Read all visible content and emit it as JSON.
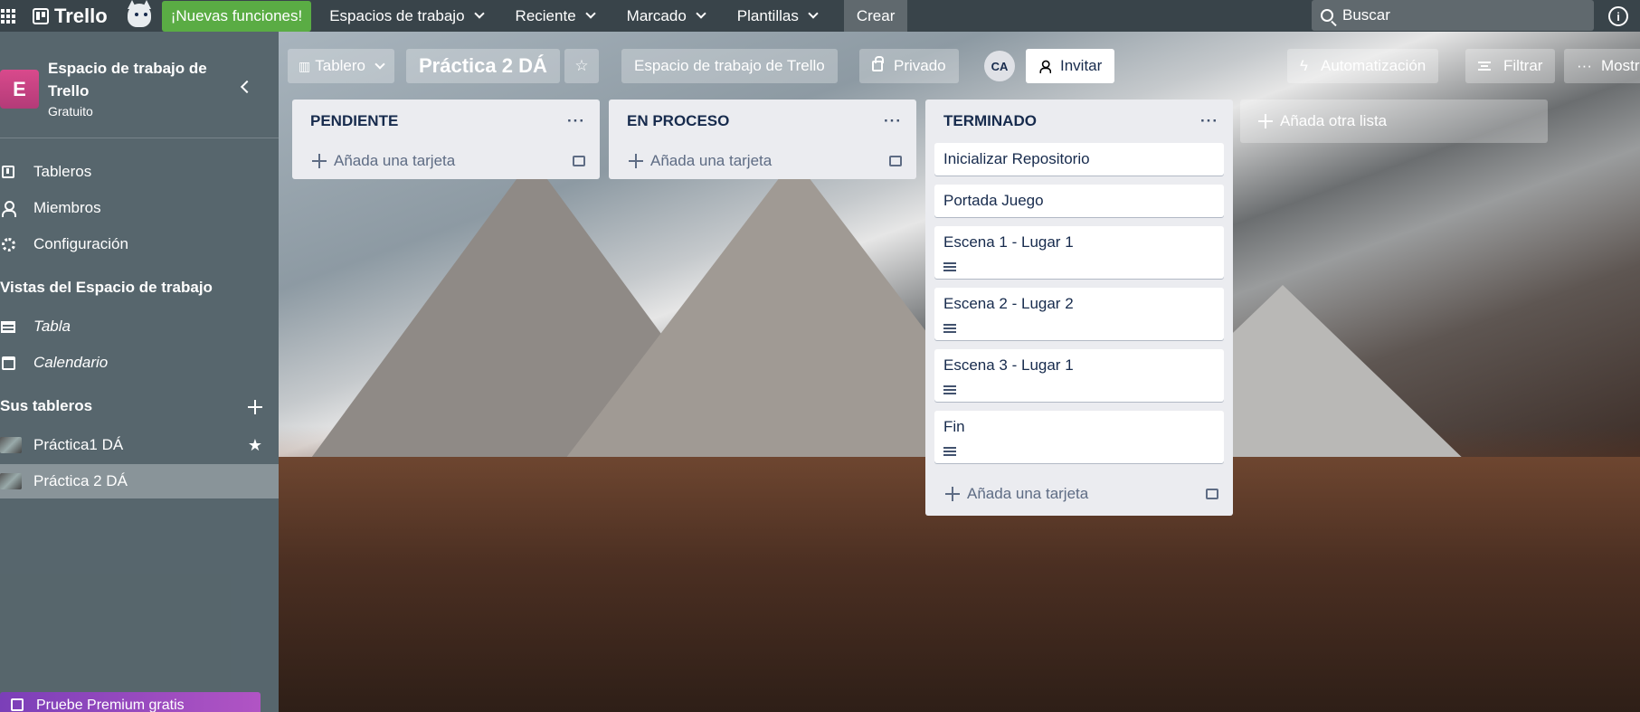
{
  "topnav": {
    "logo": "Trello",
    "new_features": "¡Nuevas funciones!",
    "menus": [
      "Espacios de trabajo",
      "Reciente",
      "Marcado",
      "Plantillas"
    ],
    "create": "Crear",
    "search_placeholder": "Buscar",
    "info": "i"
  },
  "sidebar": {
    "workspace_initial": "E",
    "workspace_name": "Espacio de trabajo de Trello",
    "plan": "Gratuito",
    "items": [
      {
        "label": "Tableros"
      },
      {
        "label": "Miembros"
      },
      {
        "label": "Configuración"
      }
    ],
    "views_heading": "Vistas del Espacio de trabajo",
    "views": [
      {
        "label": "Tabla"
      },
      {
        "label": "Calendario"
      }
    ],
    "boards_heading": "Sus tableros",
    "boards": [
      {
        "label": "Práctica1 DÁ",
        "starred": true
      },
      {
        "label": "Práctica 2 DÁ",
        "active": true
      }
    ],
    "premium": "Pruebe Premium gratis"
  },
  "board": {
    "view_button": "Tablero",
    "name": "Práctica 2 DÁ",
    "workspace_button": "Espacio de trabajo de Trello",
    "visibility": "Privado",
    "member_initials": "CA",
    "invite": "Invitar",
    "automation": "Automatización",
    "filter": "Filtrar",
    "show_menu": "Mostr",
    "add_list": "Añada otra lista",
    "add_card": "Añada una tarjeta",
    "lists": [
      {
        "title": "PENDIENTE",
        "cards": []
      },
      {
        "title": "EN PROCESO",
        "cards": []
      },
      {
        "title": "TERMINADO",
        "cards": [
          {
            "title": "Inicializar Repositorio",
            "has_description": false
          },
          {
            "title": "Portada Juego",
            "has_description": false
          },
          {
            "title": "Escena 1 - Lugar 1",
            "has_description": true
          },
          {
            "title": "Escena 2 - Lugar 2",
            "has_description": true
          },
          {
            "title": "Escena 3 - Lugar 1",
            "has_description": true
          },
          {
            "title": "Fin",
            "has_description": true
          }
        ]
      }
    ]
  }
}
